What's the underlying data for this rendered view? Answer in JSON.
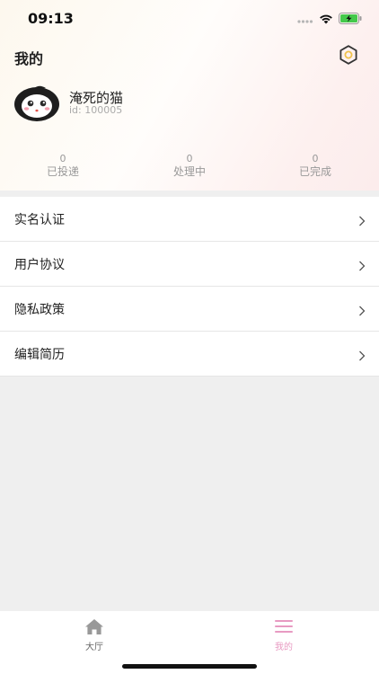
{
  "status": {
    "time": "09:13"
  },
  "header": {
    "title": "我的"
  },
  "user": {
    "name": "淹死的猫",
    "id_text": "id: 100005"
  },
  "stats": [
    {
      "count": "0",
      "label": "已投递"
    },
    {
      "count": "0",
      "label": "处理中"
    },
    {
      "count": "0",
      "label": "已完成"
    }
  ],
  "menu": [
    {
      "label": "实名认证"
    },
    {
      "label": "用户协议"
    },
    {
      "label": "隐私政策"
    },
    {
      "label": "编辑简历"
    }
  ],
  "tabbar": {
    "tabs": [
      {
        "label": "大厅",
        "icon": "home-icon",
        "active": false
      },
      {
        "label": "我的",
        "icon": "menu-icon",
        "active": true
      }
    ],
    "active_color": "#e89ac2",
    "inactive_color": "#999999"
  }
}
